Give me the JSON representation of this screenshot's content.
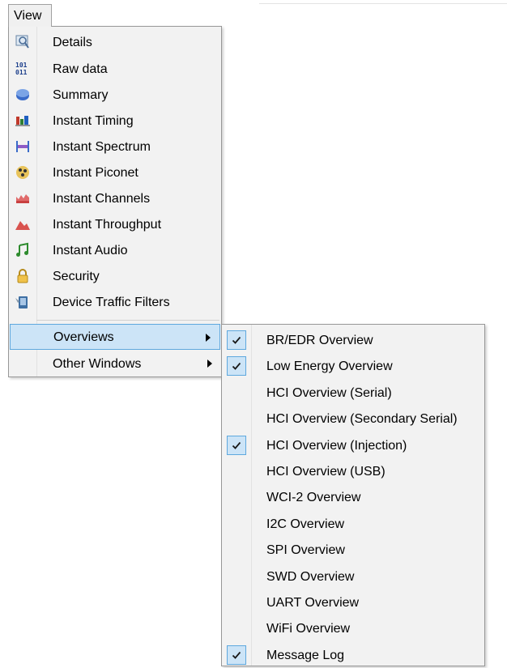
{
  "menubar": {
    "view_label": "View"
  },
  "view_menu": {
    "items": [
      {
        "label": "Details",
        "icon": "details-icon"
      },
      {
        "label": "Raw data",
        "icon": "raw-data-icon"
      },
      {
        "label": "Summary",
        "icon": "summary-icon"
      },
      {
        "label": "Instant Timing",
        "icon": "instant-timing-icon"
      },
      {
        "label": "Instant Spectrum",
        "icon": "instant-spectrum-icon"
      },
      {
        "label": "Instant Piconet",
        "icon": "instant-piconet-icon"
      },
      {
        "label": "Instant Channels",
        "icon": "instant-channels-icon"
      },
      {
        "label": "Instant Throughput",
        "icon": "instant-throughput-icon"
      },
      {
        "label": "Instant Audio",
        "icon": "instant-audio-icon"
      },
      {
        "label": "Security",
        "icon": "lock-icon"
      },
      {
        "label": "Device Traffic Filters",
        "icon": "device-filter-icon"
      }
    ],
    "overviews_label": "Overviews",
    "other_windows_label": "Other Windows"
  },
  "overviews_submenu": {
    "items": [
      {
        "label": "BR/EDR Overview",
        "checked": true
      },
      {
        "label": "Low Energy Overview",
        "checked": true
      },
      {
        "label": "HCI Overview (Serial)",
        "checked": false
      },
      {
        "label": "HCI Overview (Secondary Serial)",
        "checked": false
      },
      {
        "label": "HCI Overview (Injection)",
        "checked": true
      },
      {
        "label": "HCI Overview (USB)",
        "checked": false
      },
      {
        "label": "WCI-2 Overview",
        "checked": false
      },
      {
        "label": "I2C Overview",
        "checked": false
      },
      {
        "label": "SPI Overview",
        "checked": false
      },
      {
        "label": "SWD Overview",
        "checked": false
      },
      {
        "label": "UART Overview",
        "checked": false
      },
      {
        "label": "WiFi Overview",
        "checked": false
      },
      {
        "label": "Message Log",
        "checked": true
      }
    ]
  },
  "colors": {
    "highlight_bg": "#cce4f7",
    "highlight_border": "#5ea8de",
    "menu_bg": "#f2f2f2"
  }
}
